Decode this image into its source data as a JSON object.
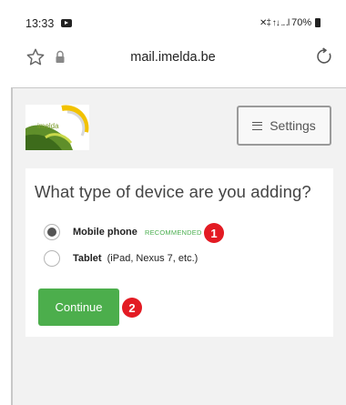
{
  "status_bar": {
    "time": "13:33",
    "battery": "70%",
    "signal_glyphs": "✕‡ ↑↓ .‥l"
  },
  "browser": {
    "url": "mail.imelda.be"
  },
  "header": {
    "logo_text": "imelda",
    "settings_label": "Settings"
  },
  "form": {
    "title": "What type of device are you adding?",
    "options": [
      {
        "label": "Mobile phone",
        "tag": "RECOMMENDED",
        "detail": "",
        "checked": true
      },
      {
        "label": "Tablet",
        "tag": "",
        "detail": "(iPad, Nexus 7, etc.)",
        "checked": false
      }
    ],
    "continue_label": "Continue"
  },
  "annotations": {
    "marker_1": "1",
    "marker_2": "2"
  },
  "colors": {
    "accent_green": "#4cae4c",
    "callout_red": "#e31b23"
  }
}
